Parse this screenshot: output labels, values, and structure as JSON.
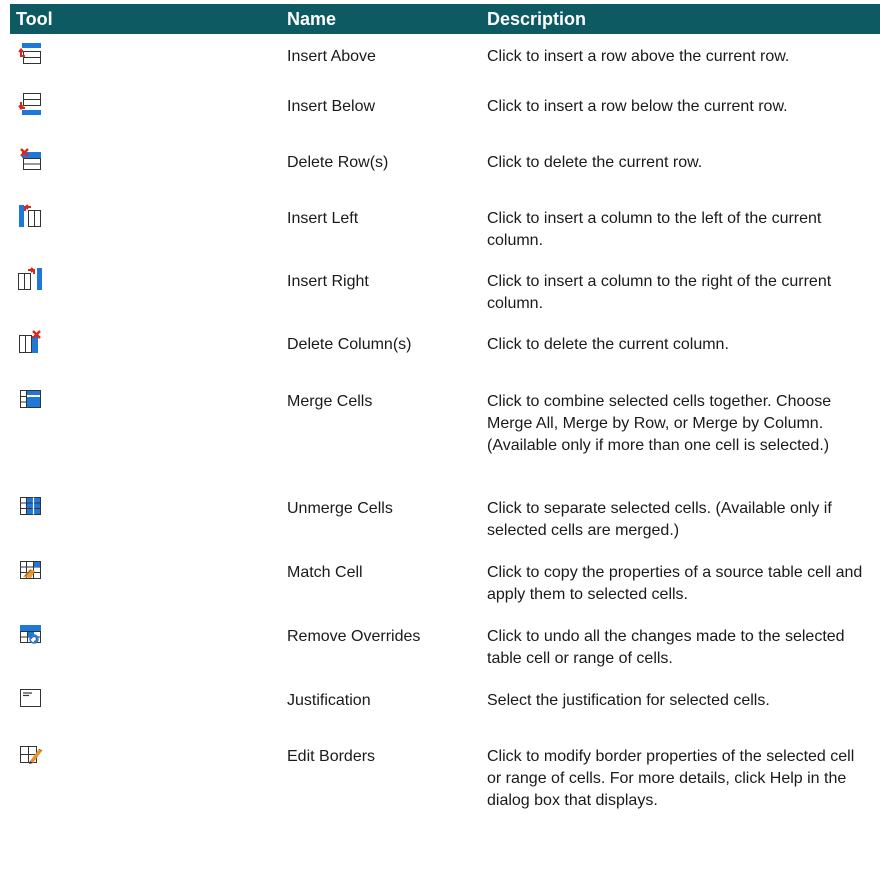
{
  "header": {
    "tool": "Tool",
    "name": "Name",
    "description": "Description"
  },
  "rows": [
    {
      "icon": "insert-above-icon",
      "name": "Insert Above",
      "description": "Click to insert a row above the current row."
    },
    {
      "icon": "insert-below-icon",
      "name": "Insert Below",
      "description": "Click to insert a row below the current row."
    },
    {
      "icon": "delete-rows-icon",
      "name": "Delete Row(s)",
      "description": "Click to delete the current row."
    },
    {
      "icon": "insert-left-icon",
      "name": "Insert Left",
      "description": "Click to insert a column to the left of the current column."
    },
    {
      "icon": "insert-right-icon",
      "name": "Insert Right",
      "description": "Click to insert a column to the right of the current column."
    },
    {
      "icon": "delete-columns-icon",
      "name": "Delete Column(s)",
      "description": "Click to delete the current column."
    },
    {
      "icon": "merge-cells-icon",
      "name": "Merge Cells",
      "description": "Click to combine selected cells together. Choose Merge All, Merge by Row, or Merge by Column. (Available only if more than one cell is selected.)"
    },
    {
      "icon": "unmerge-cells-icon",
      "name": "Unmerge Cells",
      "description": "Click to separate selected cells. (Available only if selected cells are merged.)"
    },
    {
      "icon": "match-cell-icon",
      "name": "Match Cell",
      "description": "Click to copy the properties of a source table cell and apply them to selected cells."
    },
    {
      "icon": "remove-overrides-icon",
      "name": "Remove Overrides",
      "description": "Click to undo all the changes made to the selected table cell or range of cells."
    },
    {
      "icon": "justification-icon",
      "name": "Justification",
      "description": "Select the justification for selected cells."
    },
    {
      "icon": "edit-borders-icon",
      "name": "Edit Borders",
      "description": "Click to modify border properties of the selected cell or range of cells. For more details, click Help in the dialog box that displays."
    }
  ],
  "colors": {
    "header_bg": "#0d5a63",
    "accent_blue": "#1e78d8",
    "accent_red": "#d42a1f",
    "accent_orange": "#e8912a"
  }
}
